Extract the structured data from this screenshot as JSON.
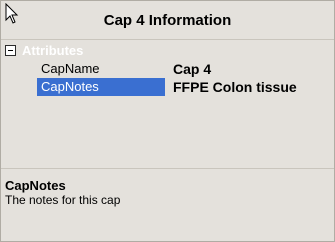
{
  "window": {
    "title": "Cap 4 Information"
  },
  "grid": {
    "category_label": "Attributes",
    "rows": [
      {
        "name": "CapName",
        "value": "Cap 4"
      },
      {
        "name": "CapNotes",
        "value": "FFPE Colon tissue"
      }
    ]
  },
  "help": {
    "title": "CapNotes",
    "description": "The notes for this cap"
  },
  "colors": {
    "selection": "#3a6fd1",
    "background": "#e4e1dc"
  }
}
